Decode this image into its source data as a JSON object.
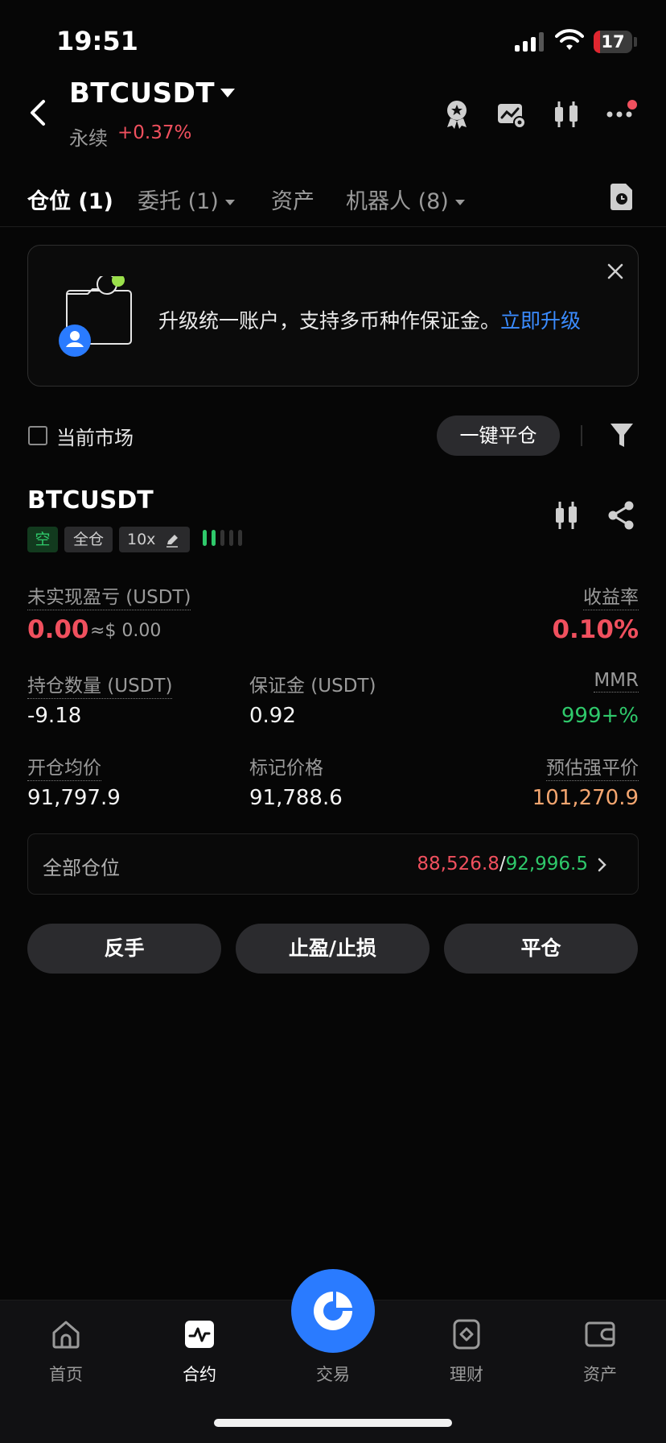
{
  "status_bar": {
    "time": "19:51",
    "battery_level": "17",
    "battery_fraction": 0.17
  },
  "header": {
    "symbol": "BTCUSDT",
    "contract_type": "永续",
    "change": "+0.37%",
    "icons": [
      "back-arrow-icon",
      "award-icon",
      "chart-settings-icon",
      "candlestick-icon",
      "more-icon"
    ]
  },
  "tabs": [
    {
      "label": "仓位 (1)",
      "active": true
    },
    {
      "label": "委托 (1)",
      "has_dropdown": true
    },
    {
      "label": "资产"
    },
    {
      "label": "机器人 (8)",
      "has_dropdown": true
    }
  ],
  "banner": {
    "text": "升级统一账户，支持多币种作保证金。",
    "link": "立即升级"
  },
  "filter": {
    "current_market_label": "当前市场",
    "close_all_label": "一键平仓"
  },
  "position": {
    "symbol": "BTCUSDT",
    "side_tag": "空",
    "margin_mode_tag": "全仓",
    "leverage_tag": "10x",
    "unrealized_pnl_label": "未实现盈亏 (USDT)",
    "unrealized_pnl": "0.00",
    "unrealized_pnl_usd": "≈$ 0.00",
    "roe_label": "收益率",
    "roe": "0.10%",
    "size_label": "持仓数量 (USDT)",
    "size": "-9.18",
    "margin_label": "保证金 (USDT)",
    "margin": "0.92",
    "mmr_label": "MMR",
    "mmr": "999+%",
    "entry_price_label": "开仓均价",
    "entry_price": "91,797.9",
    "mark_price_label": "标记价格",
    "mark_price": "91,788.6",
    "liq_price_label": "预估强平价",
    "liq_price": "101,270.9"
  },
  "all_positions": {
    "label": "全部仓位",
    "value_red": "88,526.8",
    "separator": "/",
    "value_green": "92,996.5"
  },
  "actions": {
    "reverse": "反手",
    "tp_sl": "止盈/止损",
    "close": "平仓"
  },
  "bottom_nav": [
    {
      "label": "首页",
      "icon": "home-icon"
    },
    {
      "label": "合约",
      "icon": "futures-icon",
      "active": true
    },
    {
      "label": "交易",
      "icon": "trade-icon"
    },
    {
      "label": "理财",
      "icon": "earn-icon"
    },
    {
      "label": "资产",
      "icon": "wallet-icon"
    }
  ],
  "colors": {
    "accent_blue": "#2a7bff",
    "up_green": "#2fc96b",
    "down_red": "#f0505e",
    "liq_orange": "#f4a670"
  }
}
